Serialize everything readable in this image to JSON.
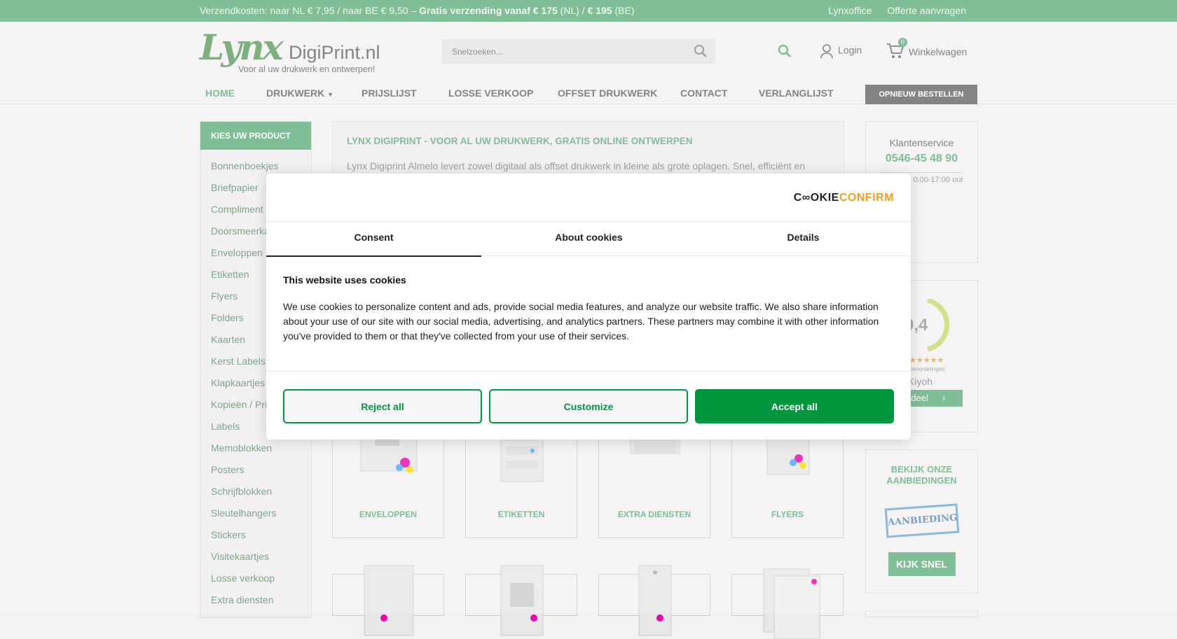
{
  "topbar": {
    "shipping_prefix": "Verzendkosten: naar NL € 7,95 / naar BE € 9,50 –",
    "free_shipping_bold": "Gratis verzending vanaf € 175",
    "nl": "(NL) /",
    "be_bold": "€ 195",
    "be": "(BE)",
    "link_office": "Lynxoffice",
    "link_quote": "Offerte aanvragen"
  },
  "header": {
    "logo_lynx": "Lynx",
    "logo_site": "DigiPrint.nl",
    "logo_tagline": "Voor al uw drukwerk en ontwerpen!",
    "search_placeholder": "Snelzoeken...",
    "login": "Login",
    "cart_count": "0",
    "cart_label": "Winkelwagen"
  },
  "nav": {
    "items": [
      "HOME",
      "DRUKWERK",
      "PRIJSLIJST",
      "LOSSE VERKOOP",
      "OFFSET DRUKWERK",
      "CONTACT",
      "VERLANGLIJST"
    ],
    "reorder": "OPNIEUW BESTELLEN"
  },
  "sidebar": {
    "header": "KIES UW PRODUCT",
    "items": [
      "Bonnenboekjes",
      "Briefpapier",
      "Compliment",
      "Doorsmeerka",
      "Enveloppen",
      "Etiketten",
      "Flyers",
      "Folders",
      "Kaarten",
      "Kerst Labels",
      "Klapkaartjes",
      "Kopieën / Pri",
      "Labels",
      "Memoblokken",
      "Posters",
      "Schrijfblokken",
      "Sleutelhangers",
      "Stickers",
      "Visitekaartjes",
      "Losse verkoop",
      "Extra diensten"
    ]
  },
  "main": {
    "title": "LYNX DIGIPRINT - VOOR AL UW DRUKWERK, GRATIS ONLINE ONTWERPEN",
    "intro": "Lynx Digiprint Almelo levert zowel digitaal als offset drukwerk in kleine als grote oplagen. Snel, efficiënt en",
    "tiles": [
      "ENVELOPPEN",
      "ETIKETTEN",
      "EXTRA DIENSTEN",
      "FLYERS"
    ]
  },
  "right": {
    "service_label": "Klantenservice",
    "service_phone": "0546-45 48 90",
    "service_hours": "0:00-17:00 uur",
    "rating": "9,4",
    "reviews_label": "beoordelingen",
    "kiyoh": "Kiyoh",
    "review_btn": "rdeel",
    "offers_title": "BEKIJK ONZE AANBIEDINGEN",
    "offers_stamp": "AANBIEDING",
    "offers_btn": "KIJK SNEL"
  },
  "cookie": {
    "brand_a": "C",
    "brand_b": "OKIE",
    "brand_c": "CONFIRM",
    "tabs": [
      "Consent",
      "About cookies",
      "Details"
    ],
    "heading": "This website uses cookies",
    "text": "We use cookies to personalize content and ads, provide social media features, and analyze our website traffic. We also share information about your use of our site with our social media, advertising, and analytics partners. These partners may combine it with other information you've provided to them or that they've collected from your use of their services.",
    "reject": "Reject all",
    "customize": "Customize",
    "accept": "Accept all"
  },
  "colors": {
    "brand_green": "#5fae7e",
    "cookie_green": "#009640"
  }
}
